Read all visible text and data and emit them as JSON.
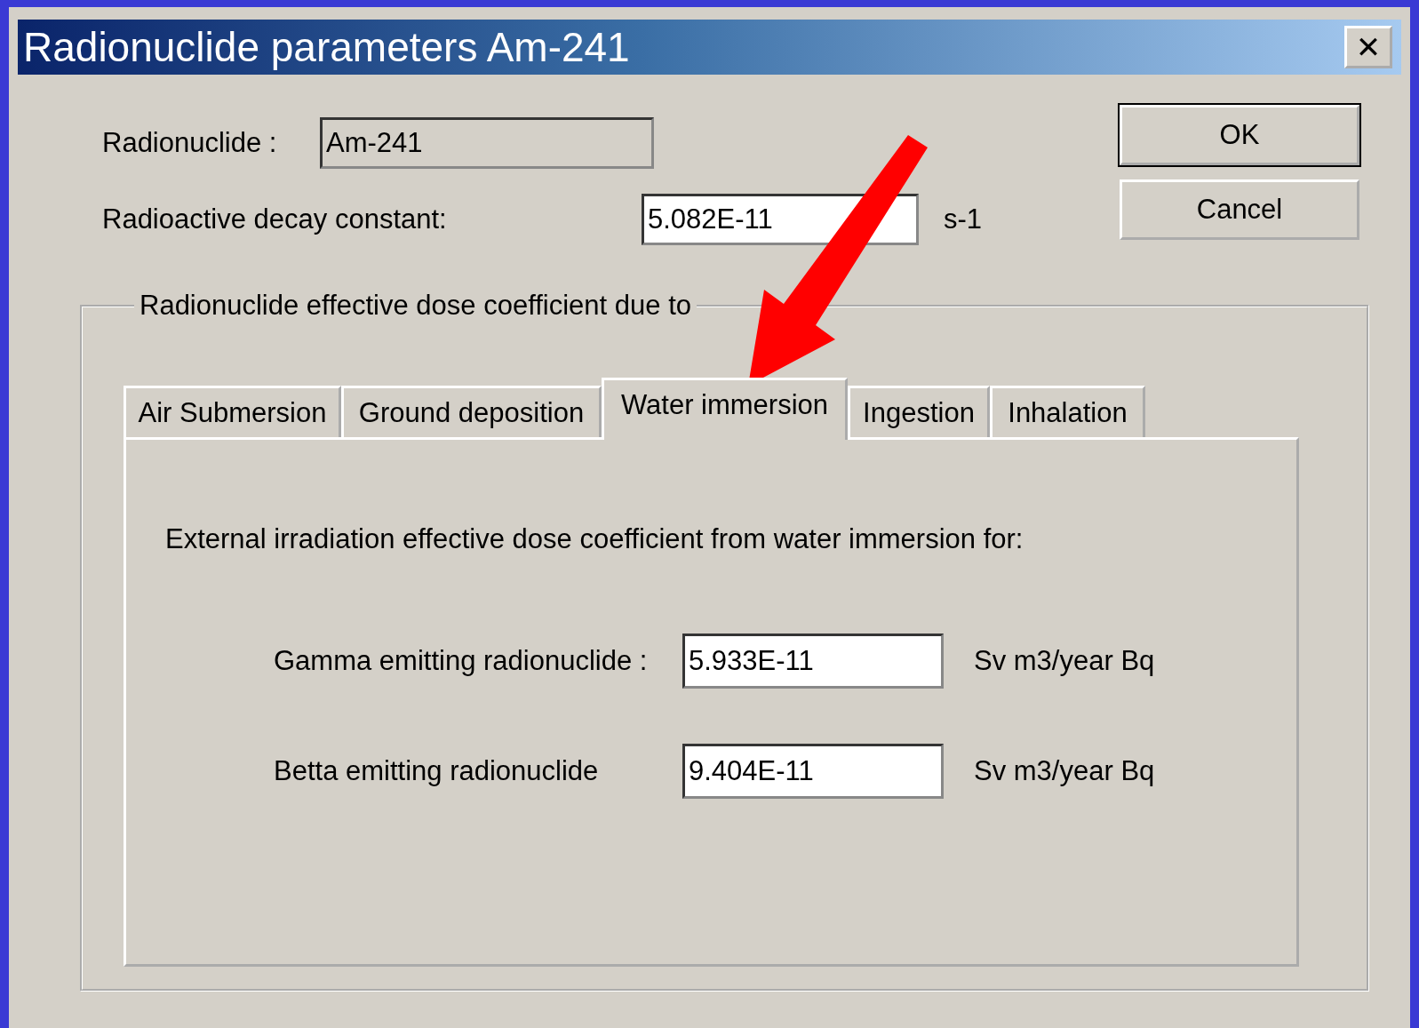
{
  "window": {
    "title": "Radionuclide parameters Am-241",
    "close": "✕"
  },
  "fields": [
    {
      "label": "Radionuclide :",
      "value": "Am-241",
      "disabled": true
    },
    {
      "label": "Radioactive decay constant:",
      "value": "5.082E-11",
      "unit": "s-1",
      "disabled": false
    }
  ],
  "buttons": [
    {
      "label": "OK",
      "default": true
    },
    {
      "label": "Cancel",
      "default": false
    }
  ],
  "group": {
    "title": "Radionuclide effective dose coefficient due to",
    "tabs": [
      {
        "label": "Air Submersion",
        "selected": false
      },
      {
        "label": "Ground deposition",
        "selected": false
      },
      {
        "label": "Water immersion",
        "selected": true
      },
      {
        "label": "Ingestion",
        "selected": false
      },
      {
        "label": "Inhalation",
        "selected": false
      }
    ],
    "panel": {
      "heading": "External irradiation effective dose coefficient from water immersion for:",
      "rows": [
        {
          "label": "Gamma emitting radionuclide :",
          "value": "5.933E-11",
          "unit": "Sv m3/year Bq"
        },
        {
          "label": "Betta emitting radionuclide",
          "value": "9.404E-11",
          "unit": "Sv m3/year Bq"
        }
      ]
    }
  }
}
